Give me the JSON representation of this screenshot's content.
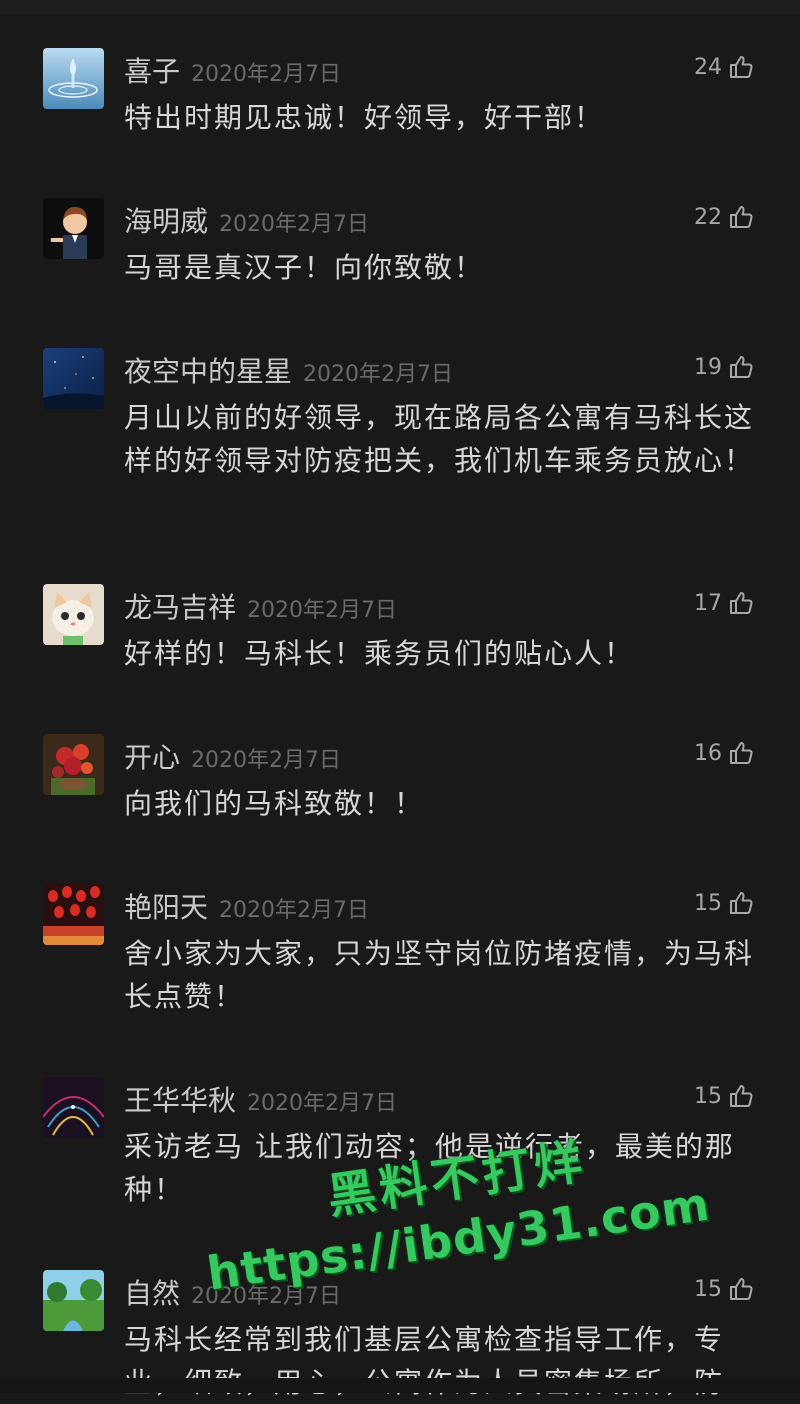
{
  "comments": [
    {
      "name": "喜子",
      "date": "2020年2月7日",
      "likes": "24",
      "text": "特出时期见忠诚！好领导，好干部！",
      "avatar": "water-drop-avatar"
    },
    {
      "name": "海明威",
      "date": "2020年2月7日",
      "likes": "22",
      "text": "马哥是真汉子！向你致敬！",
      "avatar": "cartoon-man-avatar"
    },
    {
      "name": "夜空中的星星",
      "date": "2020年2月7日",
      "likes": "19",
      "text": "月山以前的好领导，现在路局各公寓有马科长这样的好领导对防疫把关，我们机车乘务员放心！",
      "avatar": "night-sky-avatar"
    },
    {
      "name": "龙马吉祥",
      "date": "2020年2月7日",
      "likes": "17",
      "text": "好样的！马科长！乘务员们的贴心人！",
      "avatar": "cat-avatar"
    },
    {
      "name": "开心",
      "date": "2020年2月7日",
      "likes": "16",
      "text": "向我们的马科致敬！！",
      "avatar": "flower-avatar"
    },
    {
      "name": "艳阳天",
      "date": "2020年2月7日",
      "likes": "15",
      "text": "舍小家为大家，只为坚守岗位防堵疫情，为马科长点赞！",
      "avatar": "lanterns-avatar"
    },
    {
      "name": "王华华秋",
      "date": "2020年2月7日",
      "likes": "15",
      "text": "采访老马 让我们动容；他是逆行者，最美的那种！",
      "avatar": "lights-avatar"
    },
    {
      "name": "自然",
      "date": "2020年2月7日",
      "likes": "15",
      "text": "马科长经常到我们基层公寓检查指导工作，专业，细致，用心，公寓作为人员密集场所，防",
      "avatar": "landscape-avatar"
    }
  ],
  "watermark": {
    "line1": "黑料不打烊",
    "line2": "https://ibdy31.com"
  },
  "icons": {
    "like": "thumbs-up-icon"
  }
}
